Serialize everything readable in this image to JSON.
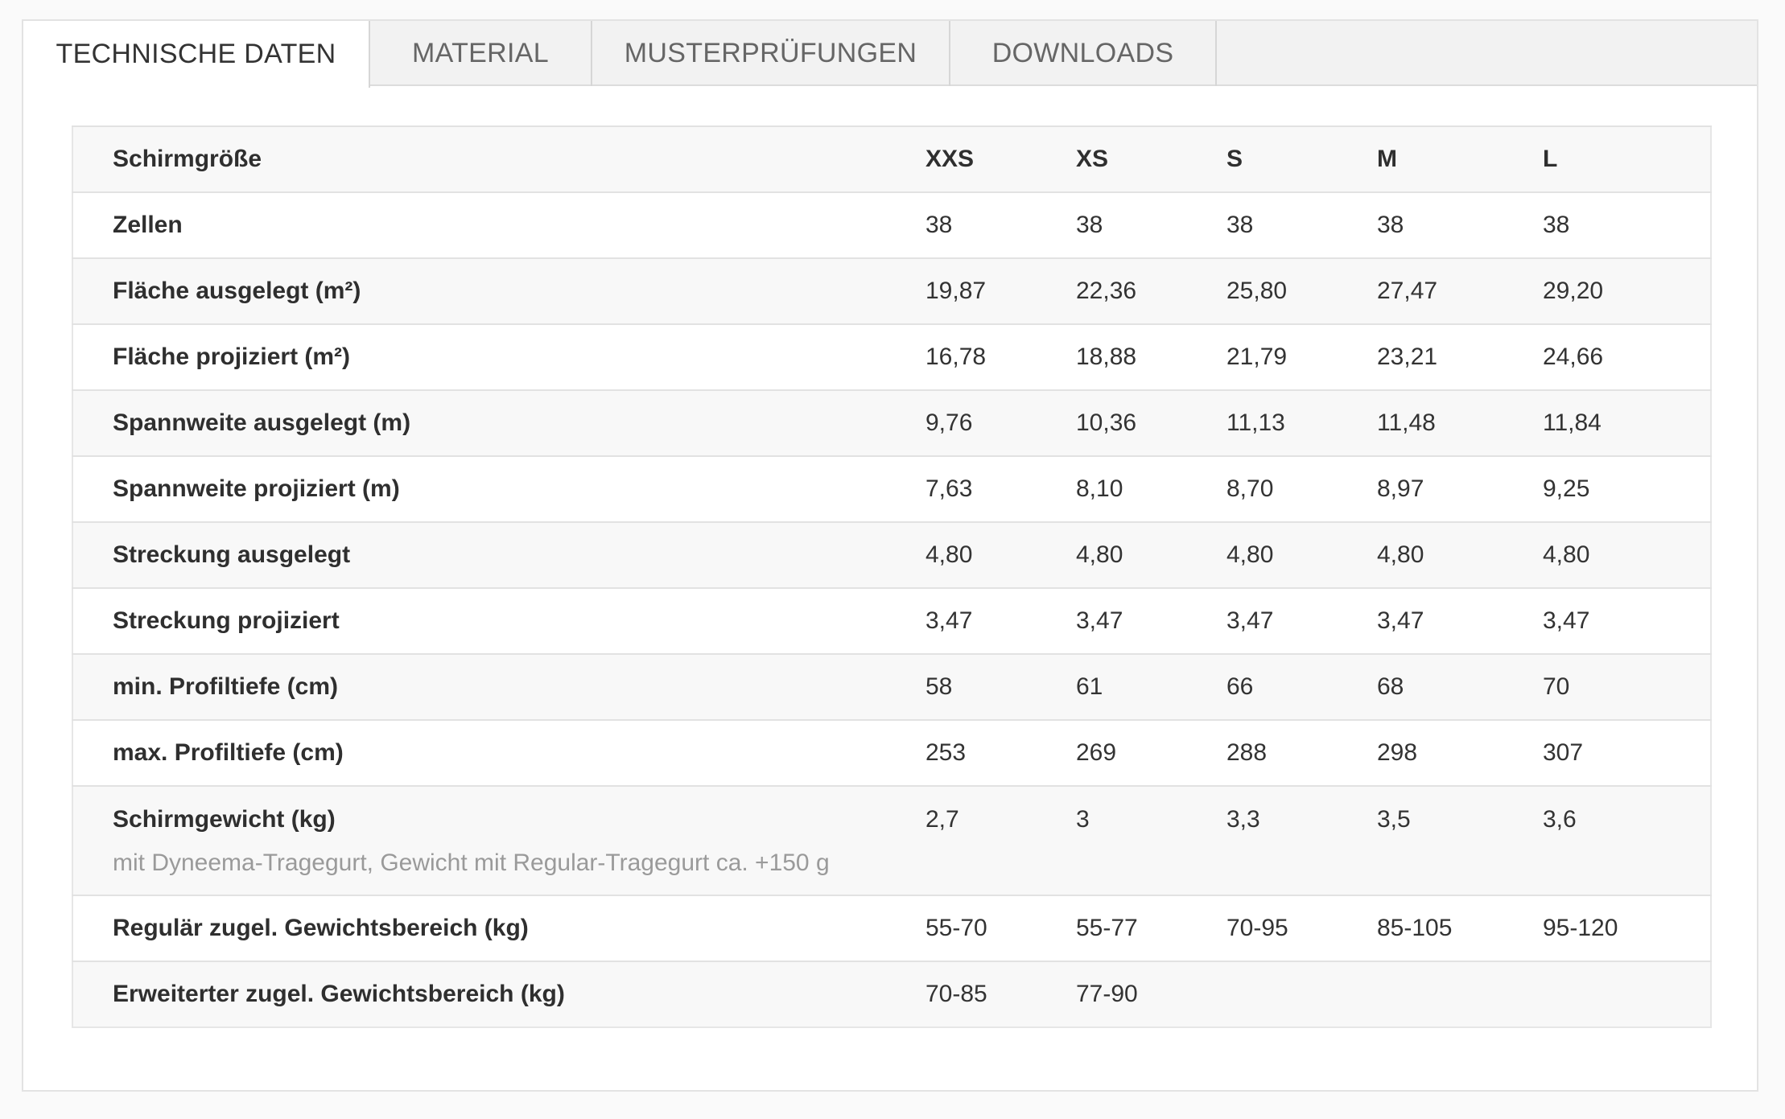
{
  "tabs": [
    {
      "label": "TECHNISCHE DATEN",
      "active": true
    },
    {
      "label": "MATERIAL",
      "active": false
    },
    {
      "label": "MUSTERPRÜFUNGEN",
      "active": false
    },
    {
      "label": "DOWNLOADS",
      "active": false
    }
  ],
  "table": {
    "header": {
      "label": "Schirmgröße",
      "cells": [
        "XXS",
        "XS",
        "S",
        "M",
        "L"
      ]
    },
    "rows": [
      {
        "label": "Zellen",
        "cells": [
          "38",
          "38",
          "38",
          "38",
          "38"
        ]
      },
      {
        "label": "Fläche ausgelegt (m²)",
        "cells": [
          "19,87",
          "22,36",
          "25,80",
          "27,47",
          "29,20"
        ]
      },
      {
        "label": "Fläche projiziert (m²)",
        "cells": [
          "16,78",
          "18,88",
          "21,79",
          "23,21",
          "24,66"
        ]
      },
      {
        "label": "Spannweite ausgelegt (m)",
        "cells": [
          "9,76",
          "10,36",
          "11,13",
          "11,48",
          "11,84"
        ]
      },
      {
        "label": "Spannweite projiziert (m)",
        "cells": [
          "7,63",
          "8,10",
          "8,70",
          "8,97",
          "9,25"
        ]
      },
      {
        "label": "Streckung ausgelegt",
        "cells": [
          "4,80",
          "4,80",
          "4,80",
          "4,80",
          "4,80"
        ]
      },
      {
        "label": "Streckung projiziert",
        "cells": [
          "3,47",
          "3,47",
          "3,47",
          "3,47",
          "3,47"
        ]
      },
      {
        "label": "min. Profiltiefe (cm)",
        "cells": [
          "58",
          "61",
          "66",
          "68",
          "70"
        ]
      },
      {
        "label": "max. Profiltiefe (cm)",
        "cells": [
          "253",
          "269",
          "288",
          "298",
          "307"
        ]
      },
      {
        "label": "Schirmgewicht (kg)",
        "note": "mit Dyneema-Tragegurt, Gewicht mit Regular-Tragegurt ca. +150 g",
        "cells": [
          "2,7",
          "3",
          "3,3",
          "3,5",
          "3,6"
        ]
      },
      {
        "label": "Regulär zugel. Gewichtsbereich (kg)",
        "cells": [
          "55-70",
          "55-77",
          "70-95",
          "85-105",
          "95-120"
        ]
      },
      {
        "label": "Erweiterter zugel. Gewichtsbereich (kg)",
        "cells": [
          "70-85",
          "77-90",
          "",
          "",
          ""
        ]
      }
    ]
  }
}
